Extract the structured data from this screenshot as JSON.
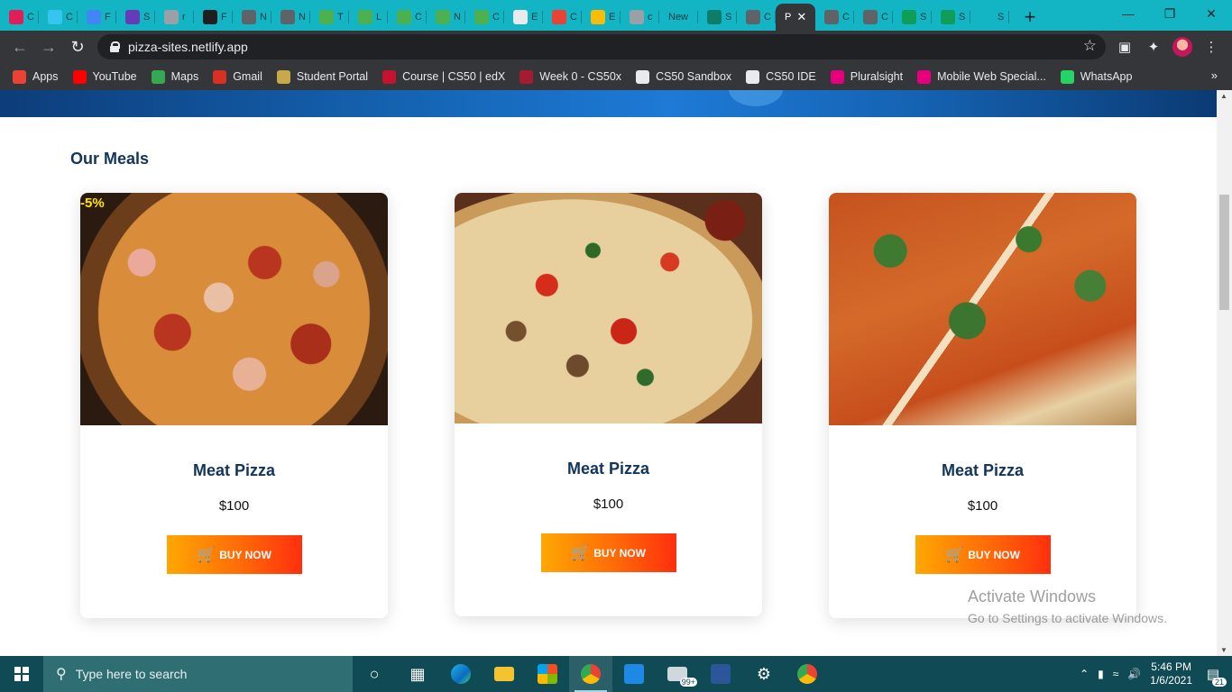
{
  "tabs": [
    {
      "label": "C",
      "color": "#e01e5a"
    },
    {
      "label": "C",
      "color": "#36c5f0"
    },
    {
      "label": "F",
      "color": "#4285f4"
    },
    {
      "label": "S",
      "color": "#673ab7"
    },
    {
      "label": "r",
      "color": "#9aa0a6"
    },
    {
      "label": "F",
      "color": "#1f1f1f"
    },
    {
      "label": "N",
      "color": "#5f6368"
    },
    {
      "label": "N",
      "color": "#5f6368"
    },
    {
      "label": "T",
      "color": "#4caf50"
    },
    {
      "label": "L",
      "color": "#4caf50"
    },
    {
      "label": "C",
      "color": "#4caf50"
    },
    {
      "label": "N",
      "color": "#4caf50"
    },
    {
      "label": "C",
      "color": "#4caf50"
    },
    {
      "label": "E",
      "color": "#e8eaed"
    },
    {
      "label": "C",
      "color": "#ea4335"
    },
    {
      "label": "E",
      "color": "#fbbc05"
    },
    {
      "label": "c",
      "color": "#9aa0a6"
    },
    {
      "label": "New",
      "color": "#13b5c4"
    },
    {
      "label": "S",
      "color": "#0d7d6a"
    },
    {
      "label": "C",
      "color": "#5f6368"
    }
  ],
  "active_tab": {
    "label": "P",
    "close": "✕"
  },
  "tabs_after": [
    {
      "label": "C",
      "color": "#5f6368"
    },
    {
      "label": "C",
      "color": "#5f6368"
    },
    {
      "label": "S",
      "color": "#0f9d58"
    },
    {
      "label": "S",
      "color": "#0f9d58"
    },
    {
      "label": "S",
      "color": "#13b5c4"
    }
  ],
  "toolbar": {
    "url": "pizza-sites.netlify.app"
  },
  "bookmarks": [
    {
      "label": "Apps",
      "color": "#ea4335"
    },
    {
      "label": "YouTube",
      "color": "#ff0000"
    },
    {
      "label": "Maps",
      "color": "#34a853"
    },
    {
      "label": "Gmail",
      "color": "#d93025"
    },
    {
      "label": "Student Portal",
      "color": "#c8a94a"
    },
    {
      "label": "Course | CS50 | edX",
      "color": "#c4132f"
    },
    {
      "label": "Week 0 - CS50x",
      "color": "#a51c30"
    },
    {
      "label": "CS50 Sandbox",
      "color": "#e8eaed"
    },
    {
      "label": "CS50 IDE",
      "color": "#e8eaed"
    },
    {
      "label": "Pluralsight",
      "color": "#e6007e"
    },
    {
      "label": "Mobile Web Special...",
      "color": "#e6007e"
    },
    {
      "label": "WhatsApp",
      "color": "#25d366"
    }
  ],
  "bookmarks_more": "»",
  "page": {
    "section_title": "Our Meals",
    "meals": [
      {
        "badge": "-5%",
        "name": "Meat Pizza",
        "price": "$100",
        "button": "BUY NOW"
      },
      {
        "badge": "",
        "name": "Meat Pizza",
        "price": "$100",
        "button": "BUY NOW"
      },
      {
        "badge": "",
        "name": "Meat Pizza",
        "price": "$100",
        "button": "BUY NOW"
      }
    ]
  },
  "watermark": {
    "line1": "Activate Windows",
    "line2": "Go to Settings to activate Windows."
  },
  "taskbar": {
    "search_placeholder": "Type here to search",
    "mail_badge": "99+",
    "time": "5:46 PM",
    "date": "1/6/2021",
    "notifications": "21"
  }
}
